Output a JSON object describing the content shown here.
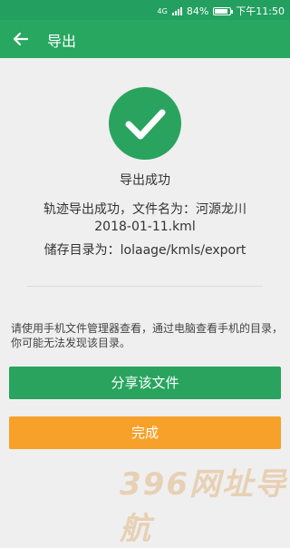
{
  "status_bar": {
    "signal": "4G",
    "battery": "84%",
    "battery_level": 0.84,
    "time": "下午11:50"
  },
  "app_bar": {
    "title": "导出",
    "back_icon": "arrow-left-icon"
  },
  "result": {
    "icon": "check-circle-icon",
    "title": "导出成功",
    "success_line1": "轨迹导出成功，文件名为：河源龙川",
    "success_line2": "2018-01-11.kml",
    "directory": "储存目录为：lolaage/kmls/export"
  },
  "hint": "请使用手机文件管理器查看，通过电脑查看手机的目录，你可能无法发现该目录。",
  "buttons": {
    "share_label": "分享该文件",
    "done_label": "完成"
  },
  "watermark": "396网址导航",
  "colors": {
    "primary": "#27a760",
    "accent_orange": "#f7a12b"
  }
}
